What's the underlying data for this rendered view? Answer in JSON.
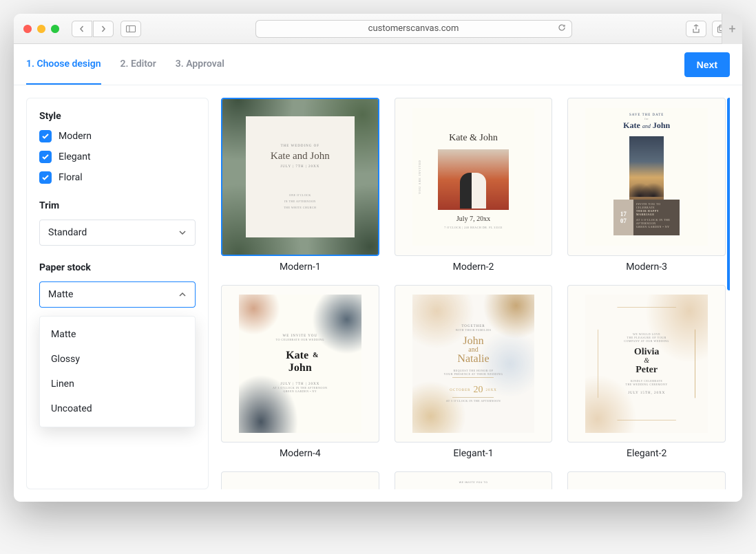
{
  "browser": {
    "url": "customerscanvas.com"
  },
  "steps": [
    {
      "label": "1. Choose design",
      "active": true
    },
    {
      "label": "2. Editor",
      "active": false
    },
    {
      "label": "3. Approval",
      "active": false
    }
  ],
  "next_button": "Next",
  "sidebar": {
    "style": {
      "label": "Style",
      "options": [
        {
          "label": "Modern",
          "checked": true
        },
        {
          "label": "Elegant",
          "checked": true
        },
        {
          "label": "Floral",
          "checked": true
        }
      ]
    },
    "trim": {
      "label": "Trim",
      "selected": "Standard"
    },
    "paper_stock": {
      "label": "Paper stock",
      "selected": "Matte",
      "options": [
        "Matte",
        "Glossy",
        "Linen",
        "Uncoated"
      ]
    }
  },
  "gallery": [
    {
      "label": "Modern-1",
      "selected": true
    },
    {
      "label": "Modern-2",
      "selected": false
    },
    {
      "label": "Modern-3",
      "selected": false
    },
    {
      "label": "Modern-4",
      "selected": false
    },
    {
      "label": "Elegant-1",
      "selected": false
    },
    {
      "label": "Elegant-2",
      "selected": false
    }
  ],
  "invite_text": {
    "m1": {
      "head": "THE WEDDING OF",
      "names": "Kate and John",
      "date": "JULY | 7TH | 20XX",
      "foot1": "ONE O'CLOCK",
      "foot2": "IN THE AFTERNOON",
      "foot3": "THE WHITE CHURCH"
    },
    "m2": {
      "names": "Kate & John",
      "date": "July 7, 20xx",
      "side": "YOU ARE INVITED",
      "foot": "7 O'CLOCK | 240 BEACH DR. FL 33333"
    },
    "m3": {
      "save": "SAVE THE DATE",
      "for": "for",
      "names_a": "Kate",
      "and": "and",
      "names_b": "John",
      "d1": "17",
      "d2": "07",
      "info1": "INVITE YOU TO CELEBRATE",
      "info2": "THEIR HAPPY MARRIAGE",
      "info3": "AT 3 O'CLOCK IN THE AFTERNOON",
      "info4": "GREEN GARDEN • NY"
    },
    "m4": {
      "head": "WE INVITE YOU",
      "sub": "TO CELEBRATE OUR WEDDING",
      "name1": "Kate",
      "name2": "John",
      "amp": "&",
      "date": "JULY | 7TH | 20XX",
      "foot1": "AT 3 O'CLOCK IN THE AFTERNOON",
      "foot2": "GREEN GARDEN • NY"
    },
    "e1": {
      "head": "TOGETHER",
      "sub": "WITH THEIR FAMILIES",
      "name1": "John",
      "and": "and",
      "name2": "Natalie",
      "req1": "REQUEST THE HONOR OF",
      "req2": "YOUR PRESENCE AT THEIR WEDDING",
      "oct": "OCTOBER",
      "day": "20",
      "year": "20XX",
      "foot": "AT 5 O'CLOCK IN THE AFTERNOON"
    },
    "e2": {
      "head1": "WE WOULD LOVE",
      "head2": "THE PLEASURE OF YOUR",
      "head3": "COMPANY AT OUR WEDDING",
      "name1": "Olivia",
      "amp": "&",
      "name2": "Peter",
      "sub": "KINDLY CELEBRATE",
      "sub2": "THE WEDDING CEREMONY",
      "date": "JULY 15TH, 20XX"
    },
    "peek": "WE INVITE YOU TO"
  }
}
